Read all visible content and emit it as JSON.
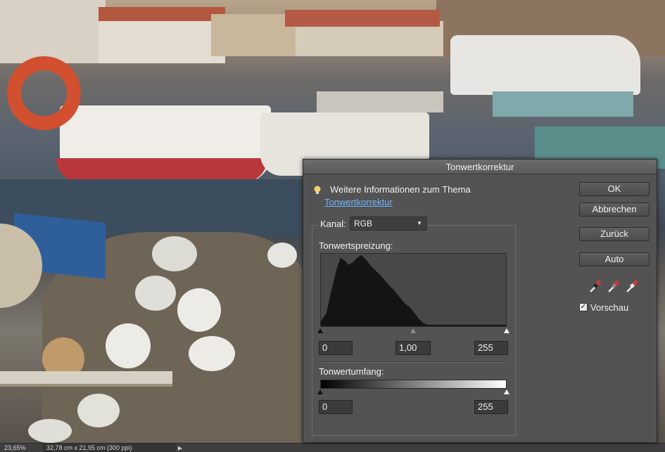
{
  "status_bar": {
    "zoom": "23,65%",
    "document_size": "32,78 cm x 21,95 cm (300 ppi)"
  },
  "dialog": {
    "title": "Tonwertkorrektur",
    "info": {
      "title": "Weitere Informationen zum Thema",
      "link": "Tonwertkorrektur",
      "icon": "lightbulb-icon"
    },
    "channel": {
      "label": "Kanal:",
      "value": "RGB"
    },
    "input_levels": {
      "label": "Tonwertspreizung:",
      "black": "0",
      "gamma": "1,00",
      "white": "255"
    },
    "output_levels": {
      "label": "Tonwertumfang:",
      "black": "0",
      "white": "255"
    },
    "buttons": {
      "ok": "OK",
      "cancel": "Abbrechen",
      "back": "Zurück",
      "auto": "Auto"
    },
    "eyedroppers": [
      "black-point-eyedropper-icon",
      "gray-point-eyedropper-icon",
      "white-point-eyedropper-icon"
    ],
    "preview": {
      "label": "Vorschau",
      "checked": true
    }
  }
}
